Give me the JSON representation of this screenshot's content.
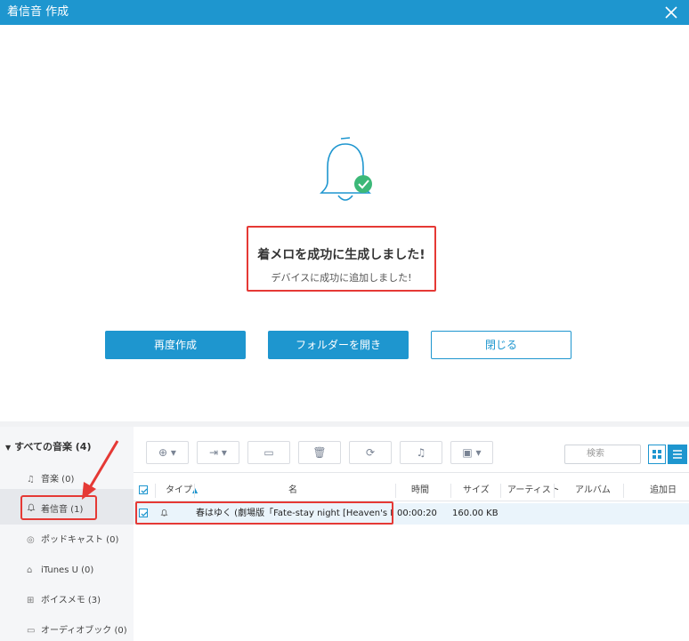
{
  "dialog": {
    "title": "着信音 作成",
    "success_title": "着メロを成功に生成しました!",
    "success_sub": "デバイスに成功に追加しました!",
    "buttons": {
      "recreate": "再度作成",
      "open_folder": "フォルダーを開き",
      "close": "閉じる"
    }
  },
  "sidebar": {
    "header": "すべての音楽 (4)",
    "items": [
      {
        "icon": "music-note-icon",
        "label": "音楽 (0)"
      },
      {
        "icon": "bell-icon",
        "label": "着信音 (1)"
      },
      {
        "icon": "podcast-icon",
        "label": "ポッドキャスト (0)"
      },
      {
        "icon": "graduation-cap-icon",
        "label": "iTunes U (0)"
      },
      {
        "icon": "voice-memo-icon",
        "label": "ボイスメモ (3)"
      },
      {
        "icon": "audiobook-icon",
        "label": "オーディオブック (0)"
      }
    ]
  },
  "toolbar": {
    "search_placeholder": "検索"
  },
  "table": {
    "columns": [
      "タイプ",
      "名",
      "時間",
      "サイズ",
      "アーティスト",
      "アルバム",
      "追加日"
    ],
    "rows": [
      {
        "name": "春はゆく (劇場版「Fate-stay night [Heaven's Feel]...",
        "time": "00:00:20",
        "size": "160.00 KB",
        "artist": "",
        "album": "",
        "added": ""
      }
    ]
  },
  "colors": {
    "accent": "#1e96cf",
    "success": "#3cb878",
    "highlight": "#e53935"
  }
}
